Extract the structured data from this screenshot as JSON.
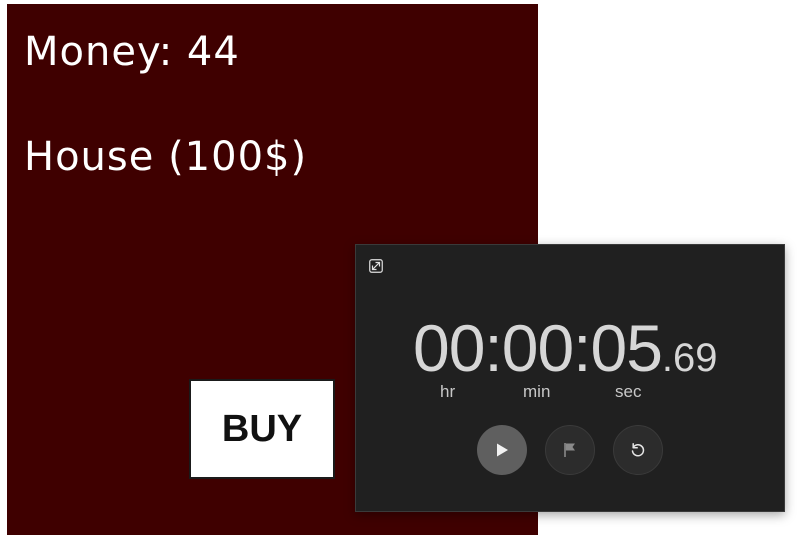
{
  "game": {
    "money_text": "Money: 44",
    "item_text": "House (100$)",
    "buy_label": "BUY",
    "colors": {
      "background": "#3f0000",
      "text": "#ffffff",
      "button": "#ffffff"
    }
  },
  "stopwatch": {
    "time_main": "00:00:05",
    "time_fraction": ".69",
    "units": {
      "hr": "hr",
      "min": "min",
      "sec": "sec"
    },
    "icons": {
      "expand": "expand-icon",
      "play": "play-icon",
      "lap": "flag-icon",
      "reset": "reset-icon"
    },
    "colors": {
      "background": "#202020",
      "digits": "#d6d6d6",
      "play_button": "#5f5f5f"
    }
  }
}
